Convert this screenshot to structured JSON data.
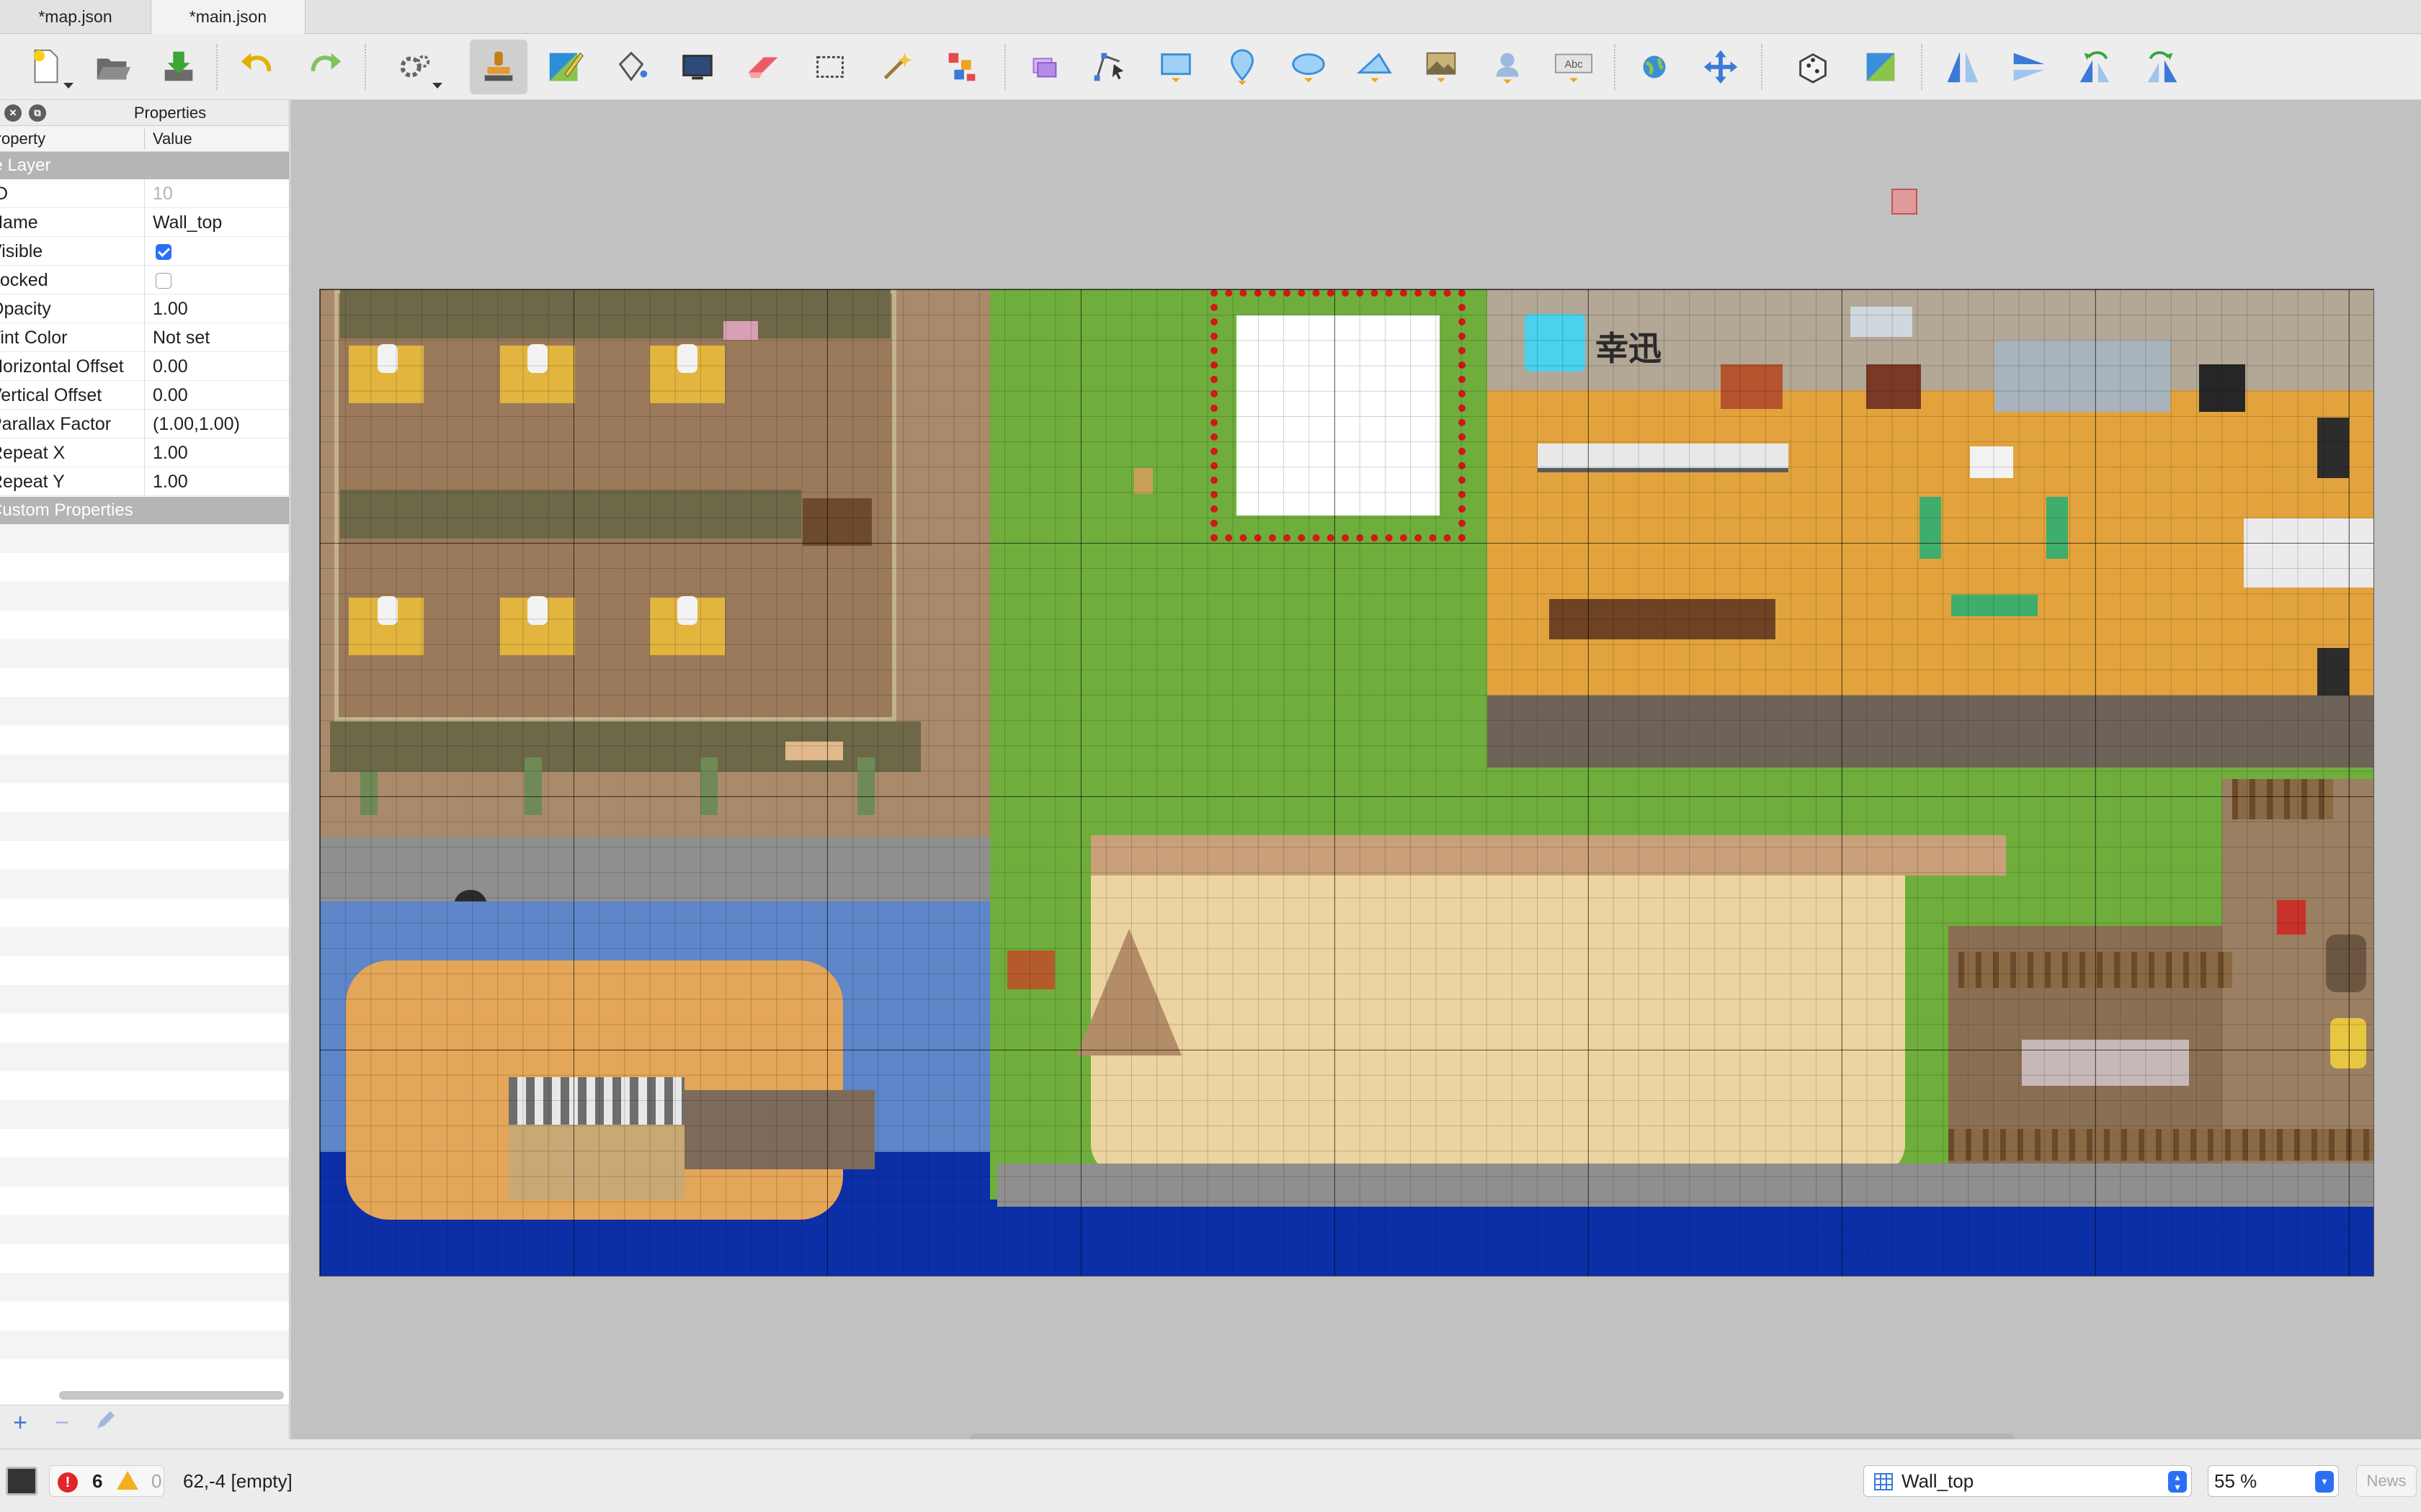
{
  "tabs": [
    {
      "label": "*map.json"
    },
    {
      "label": "*main.json"
    }
  ],
  "toolbar": {
    "icons": [
      "new-map-icon",
      "open-icon",
      "save-icon",
      "undo-icon",
      "redo-icon",
      "commands-icon",
      "stamp-brush-icon",
      "terrain-brush-icon",
      "bucket-fill-icon",
      "shape-fill-icon",
      "eraser-icon",
      "rectangle-select-icon",
      "magic-wand-icon",
      "select-same-tile-icon",
      "select-objects-icon",
      "edit-polygons-icon",
      "insert-rectangle-icon",
      "insert-point-icon",
      "insert-ellipse-icon",
      "insert-polygon-icon",
      "insert-tile-icon",
      "insert-template-icon",
      "insert-text-icon",
      "world-tool-icon",
      "move-icon",
      "random-mode-icon",
      "wang-fill-icon",
      "flip-horizontal-icon",
      "flip-vertical-icon",
      "rotate-left-icon",
      "rotate-right-icon"
    ],
    "active_tool": "stamp-brush-icon",
    "text_tool_label": "Abc"
  },
  "properties": {
    "panel_title": "Properties",
    "col_property": "Property",
    "col_value": "Value",
    "group_layer": "Tile Layer",
    "group_custom": "Custom Properties",
    "rows": [
      {
        "key": "ID",
        "value": "10",
        "disabled": true
      },
      {
        "key": "Name",
        "value": "Wall_top"
      },
      {
        "key": "Visible",
        "value": "",
        "checkbox": true,
        "checked": true
      },
      {
        "key": "Locked",
        "value": "",
        "checkbox": true,
        "checked": false
      },
      {
        "key": "Opacity",
        "value": "1.00"
      },
      {
        "key": "Tint Color",
        "value": "Not set"
      },
      {
        "key": "Horizontal Offset",
        "value": "0.00"
      },
      {
        "key": "Vertical Offset",
        "value": "0.00"
      },
      {
        "key": "Parallax Factor",
        "value": "(1.00,1.00)"
      },
      {
        "key": "Repeat X",
        "value": "1.00"
      },
      {
        "key": "Repeat Y",
        "value": "1.00"
      }
    ]
  },
  "map": {
    "office_sign_text": "幸迅"
  },
  "status": {
    "errors": "6",
    "warnings": "0",
    "coords": "62,-4 [empty]",
    "current_layer": "Wall_top",
    "zoom": "55 %",
    "news_label": "News"
  },
  "colors": {
    "accent": "#2b6ff5",
    "error": "#e0252b",
    "warning": "#f2b01e",
    "grass": "#6fae3c",
    "water": "#0c2fa8"
  }
}
